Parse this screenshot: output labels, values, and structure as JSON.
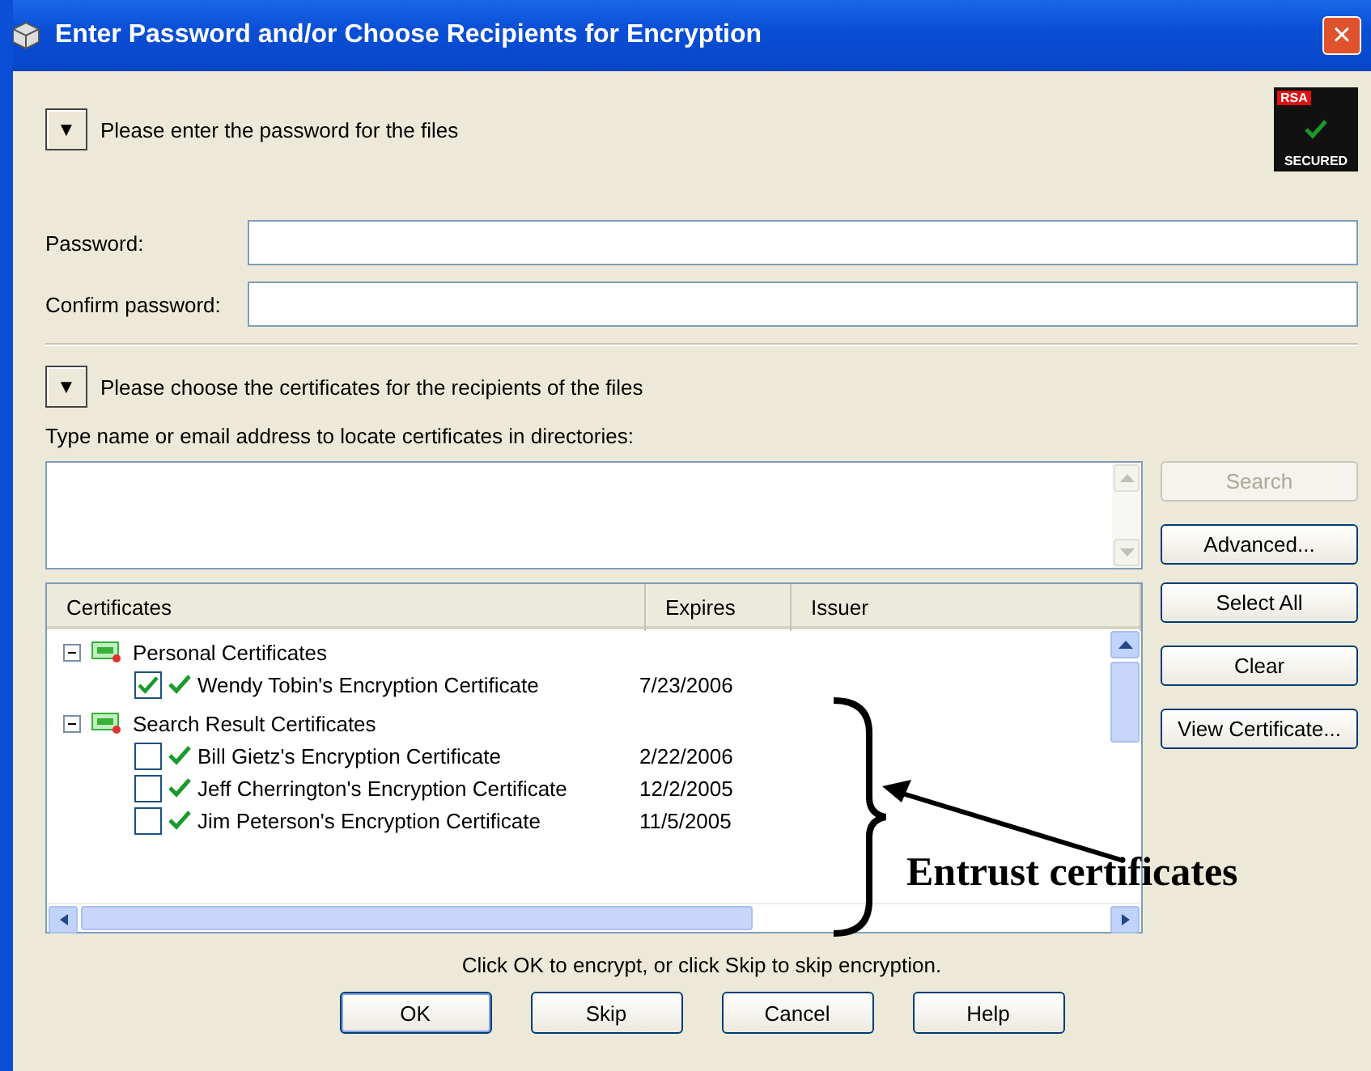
{
  "window": {
    "title": "Enter Password and/or Choose Recipients for Encryption",
    "close": "×"
  },
  "password_section": {
    "toggle": "▼",
    "heading": "Please enter the password for the files",
    "badge_top": "RSA",
    "badge_bottom": "SECURED",
    "fields": [
      {
        "label": "Password:"
      },
      {
        "label": "Confirm password:"
      }
    ]
  },
  "recipients_section": {
    "toggle": "▼",
    "heading": "Please choose the certificates for the recipients of the files",
    "search_label": "Type name or email address to locate certificates in directories:",
    "side_buttons": [
      {
        "label": "Search",
        "disabled": true
      },
      {
        "label": "Advanced...",
        "disabled": false
      },
      {
        "label": "Select All",
        "disabled": false
      },
      {
        "label": "Clear",
        "disabled": false
      },
      {
        "label": "View Certificate...",
        "disabled": false
      }
    ],
    "table": {
      "columns": [
        "Certificates",
        "Expires",
        "Issuer"
      ],
      "tree": [
        {
          "label": "Personal Certificates",
          "expanded": true,
          "children": [
            {
              "label": "Wendy Tobin's Encryption Certificate",
              "expires": "7/23/2006",
              "checked": true
            }
          ]
        },
        {
          "label": "Search Result Certificates",
          "expanded": true,
          "children": [
            {
              "label": "Bill Gietz's Encryption Certificate",
              "expires": "2/22/2006",
              "checked": false
            },
            {
              "label": "Jeff Cherrington's Encryption Certificate",
              "expires": "12/2/2005",
              "checked": false
            },
            {
              "label": "Jim Peterson's Encryption Certificate",
              "expires": "11/5/2005",
              "checked": false
            }
          ]
        }
      ]
    }
  },
  "footer": {
    "hint": "Click OK to encrypt, or click Skip to skip encryption.",
    "buttons": [
      {
        "label": "OK",
        "default": true
      },
      {
        "label": "Skip",
        "default": false
      },
      {
        "label": "Cancel",
        "default": false
      },
      {
        "label": "Help",
        "default": false
      }
    ]
  },
  "annotation": {
    "text": "Entrust certificates"
  }
}
